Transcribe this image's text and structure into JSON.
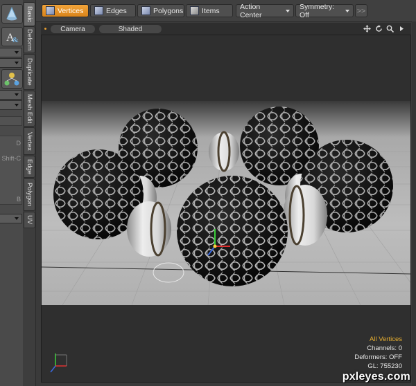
{
  "leftpanel": {
    "text_d": "D",
    "text_shift": "Shift-C",
    "text_b": "B"
  },
  "vtabs": [
    "Basic",
    "Deform",
    "Duplicate",
    "Mesh Edit",
    "Vertex",
    "Edge",
    "Polygon",
    "UV"
  ],
  "toolbar": {
    "vertices": "Vertices",
    "edges": "Edges",
    "polygons": "Polygons",
    "items": "Items",
    "action_center": "Action Center",
    "symmetry": "Symmetry: Off",
    "more": ">>"
  },
  "viewport": {
    "camera": "Camera",
    "shaded": "Shaded",
    "info": {
      "selection": "All Vertices",
      "channels": "Channels: 0",
      "deformers": "Deformers: OFF",
      "gl": "GL: 755230"
    }
  },
  "colors": {
    "accent": "#e9a030",
    "active_tab": "#f2a43a"
  },
  "icons": [
    "cone-icon",
    "text-tool-icon",
    "hierarchy-icon",
    "vertex-cube-icon",
    "move-view-icon",
    "rotate-view-icon",
    "zoom-view-icon",
    "expand-arrow-icon"
  ],
  "watermark": "pxleyes.com"
}
